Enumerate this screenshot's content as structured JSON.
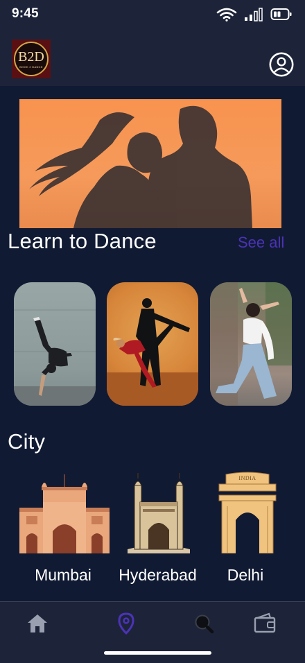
{
  "status_bar": {
    "time": "9:45",
    "icons": [
      "wifi-icon",
      "signal-icon",
      "battery-icon"
    ]
  },
  "header": {
    "logo_text": "B2D",
    "logo_subtext": "BOOK 2 DANCE",
    "profile_icon": "user-circle-icon"
  },
  "learn": {
    "title": "Learn to Dance",
    "see_all": "See all"
  },
  "city": {
    "title": "City",
    "items": [
      {
        "name": "Mumbai",
        "icon": "gateway-of-india-icon"
      },
      {
        "name": "Hyderabad",
        "icon": "charminar-icon"
      },
      {
        "name": "Delhi",
        "icon": "india-gate-icon",
        "inscription": "INDIA"
      }
    ]
  },
  "bottom_nav": {
    "items": [
      "home-icon",
      "location-pin-icon",
      "search-icon",
      "wallet-icon"
    ],
    "active": "location-pin-icon"
  },
  "colors": {
    "background": "#111a33",
    "bar": "#1d2439",
    "accent": "#4b33b8",
    "hero": "#f59a5b"
  }
}
